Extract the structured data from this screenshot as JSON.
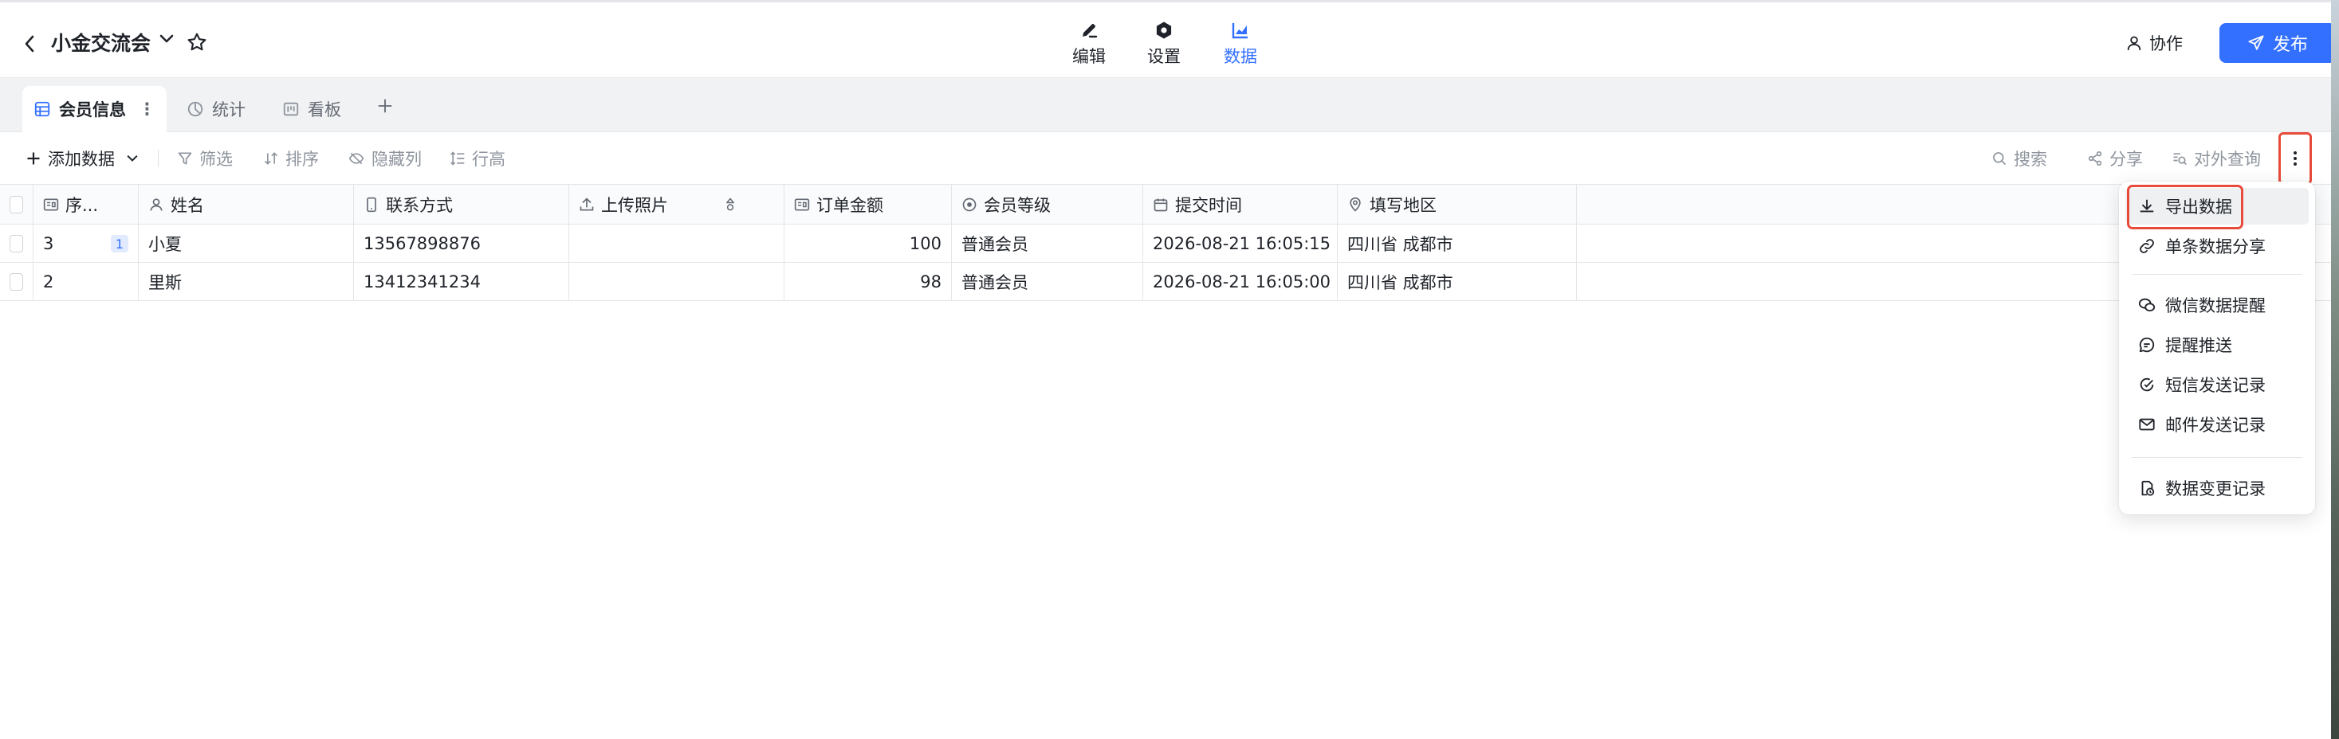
{
  "header": {
    "title": "小金交流会",
    "tabs": [
      {
        "label": "编辑",
        "icon": "pen-icon"
      },
      {
        "label": "设置",
        "icon": "settings-icon"
      },
      {
        "label": "数据",
        "icon": "chart-icon",
        "active": true
      }
    ],
    "collab_label": "协作",
    "publish_label": "发布"
  },
  "views": {
    "tabs": [
      {
        "label": "会员信息",
        "icon": "table-icon",
        "active": true
      },
      {
        "label": "统计",
        "icon": "pie-chart-icon"
      },
      {
        "label": "看板",
        "icon": "kanban-icon"
      }
    ]
  },
  "toolbar": {
    "add_data": "添加数据",
    "filter": "筛选",
    "sort": "排序",
    "hide_columns": "隐藏列",
    "row_height": "行高",
    "search": "搜索",
    "share": "分享",
    "public_query": "对外查询"
  },
  "table": {
    "columns": [
      {
        "label": "序...",
        "icon": "id-card-icon"
      },
      {
        "label": "姓名",
        "icon": "person-icon"
      },
      {
        "label": "联系方式",
        "icon": "phone-icon"
      },
      {
        "label": "上传照片",
        "icon": "upload-icon"
      },
      {
        "label": "",
        "icon": "sort-icon"
      },
      {
        "label": "订单金额",
        "icon": "id-card-icon"
      },
      {
        "label": "会员等级",
        "icon": "radio-icon"
      },
      {
        "label": "提交时间",
        "icon": "calendar-icon"
      },
      {
        "label": "填写地区",
        "icon": "location-icon"
      }
    ],
    "rows": [
      {
        "seq": "3",
        "badge": "1",
        "name": "小夏",
        "phone": "13567898876",
        "photo": "",
        "amount": "100",
        "level": "普通会员",
        "time": "2026-08-21 16:05:15",
        "region": "四川省 成都市"
      },
      {
        "seq": "2",
        "badge": "",
        "name": "里斯",
        "phone": "13412341234",
        "photo": "",
        "amount": "98",
        "level": "普通会员",
        "time": "2026-08-21 16:05:00",
        "region": "四川省 成都市"
      }
    ]
  },
  "menu": {
    "items": [
      {
        "label": "导出数据",
        "icon": "download-icon",
        "highlighted": true
      },
      {
        "label": "单条数据分享",
        "icon": "link-icon"
      },
      {
        "label": "微信数据提醒",
        "icon": "wechat-icon"
      },
      {
        "label": "提醒推送",
        "icon": "message-icon"
      },
      {
        "label": "短信发送记录",
        "icon": "sms-icon"
      },
      {
        "label": "邮件发送记录",
        "icon": "mail-icon"
      },
      {
        "label": "数据变更记录",
        "icon": "history-icon"
      }
    ]
  },
  "colors": {
    "accent": "#3370ff",
    "highlight_border": "#e84b3c"
  }
}
